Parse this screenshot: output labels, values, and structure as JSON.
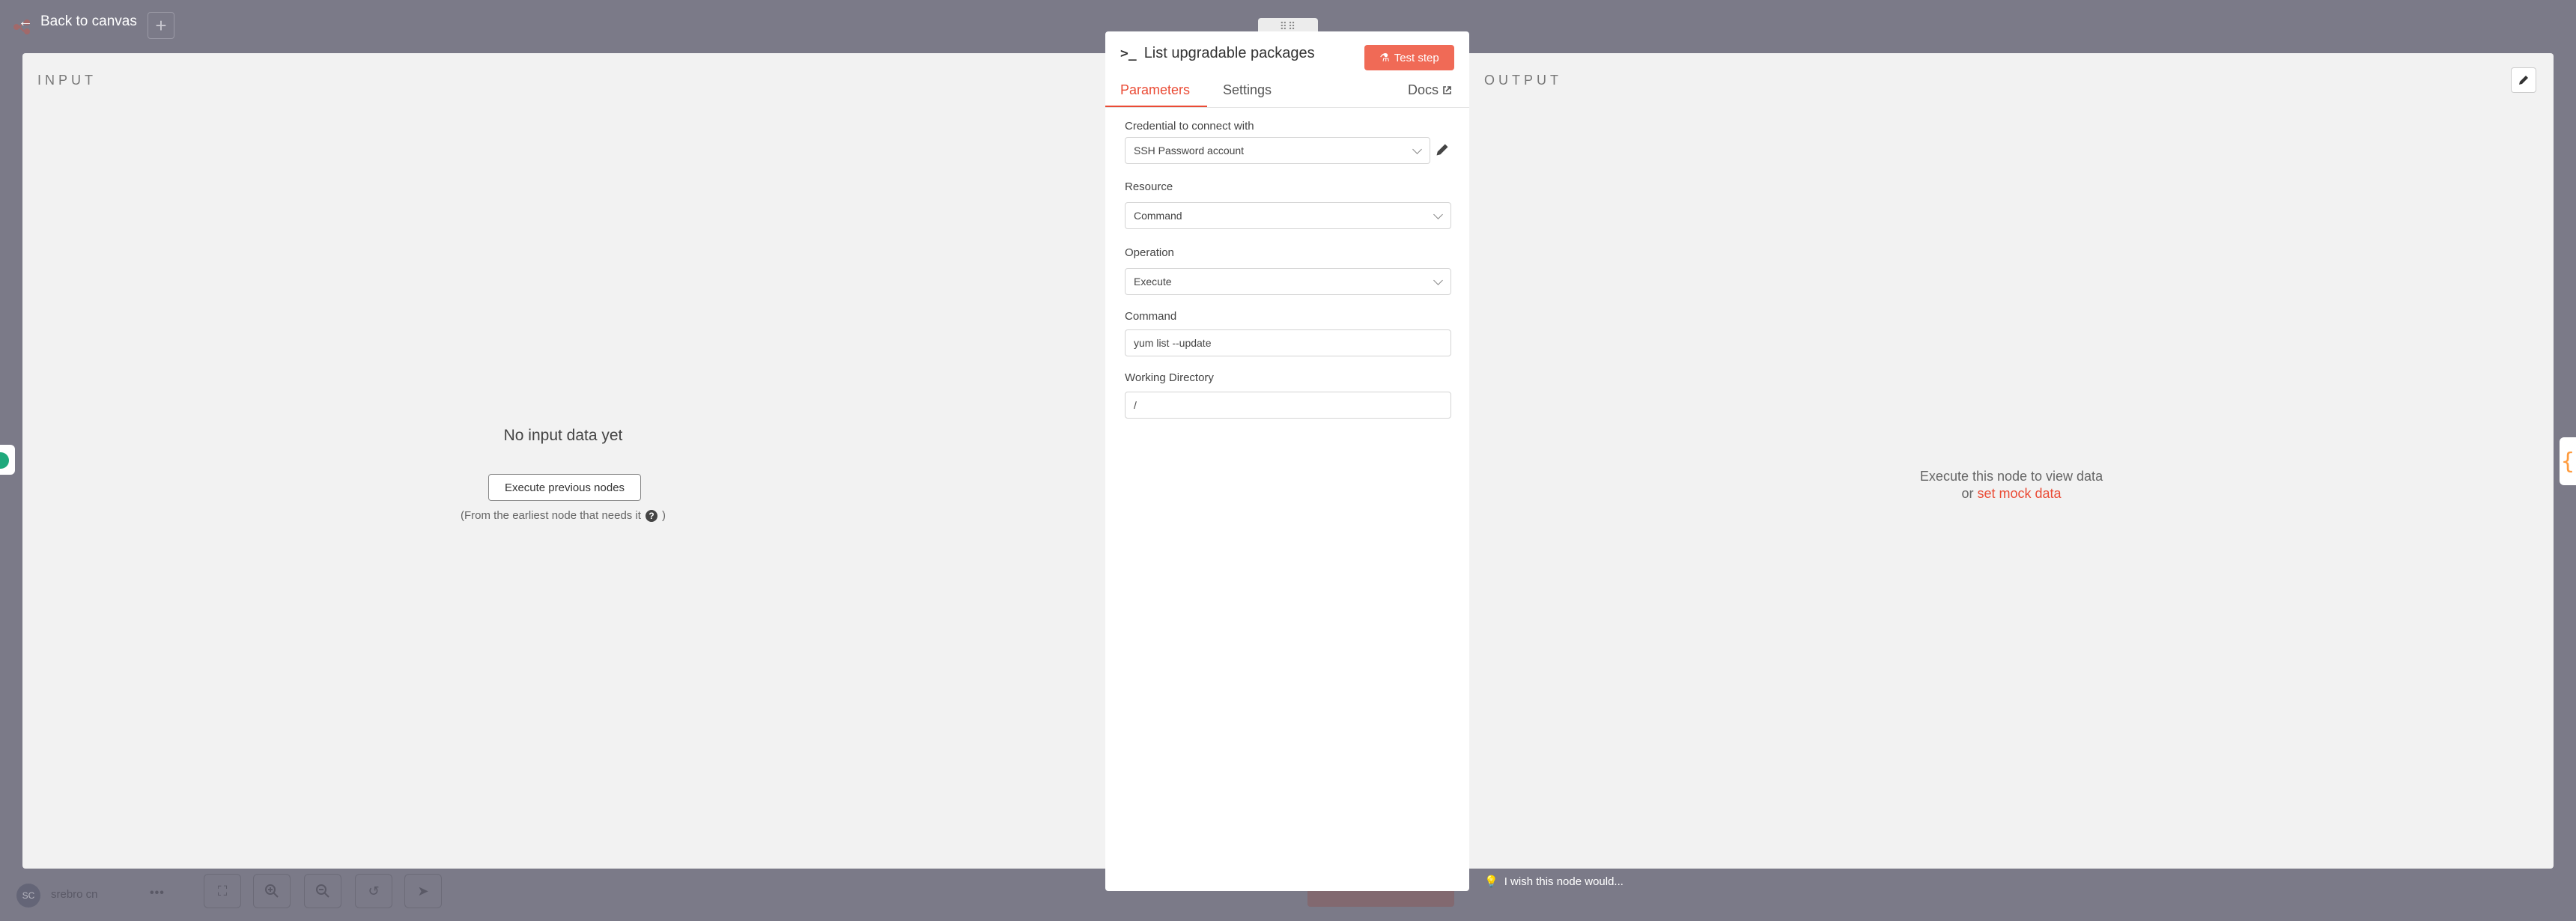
{
  "topbar": {
    "back_label": "Back to canvas",
    "add_label": "+"
  },
  "input": {
    "title": "INPUT",
    "empty_title": "No input data yet",
    "execute_button": "Execute previous nodes",
    "hint_before": "(From the earliest node that needs it",
    "hint_after": ")"
  },
  "output": {
    "title": "OUTPUT",
    "message_line1": "Execute this node to view data",
    "message_or": "or",
    "mock_link": "set mock data"
  },
  "node": {
    "icon_text": ">_",
    "title": "List upgradable packages",
    "test_button": "Test step",
    "tabs": [
      {
        "label": "Parameters",
        "active": true
      },
      {
        "label": "Settings",
        "active": false
      }
    ],
    "docs_label": "Docs"
  },
  "fields": {
    "credential": {
      "label": "Credential to connect with",
      "value": "SSH Password account"
    },
    "resource": {
      "label": "Resource",
      "value": "Command"
    },
    "operation": {
      "label": "Operation",
      "value": "Execute"
    },
    "command": {
      "label": "Command",
      "value": "yum list --update"
    },
    "working_dir": {
      "label": "Working Directory",
      "value": "/"
    }
  },
  "footer": {
    "avatar_initials": "SC",
    "user_name": "srebro cn",
    "more": "•••",
    "wish_text": "I wish this node would..."
  },
  "colors": {
    "accent": "#ea4b35",
    "button": "#f06a56",
    "backdrop": "#7b7a88"
  }
}
